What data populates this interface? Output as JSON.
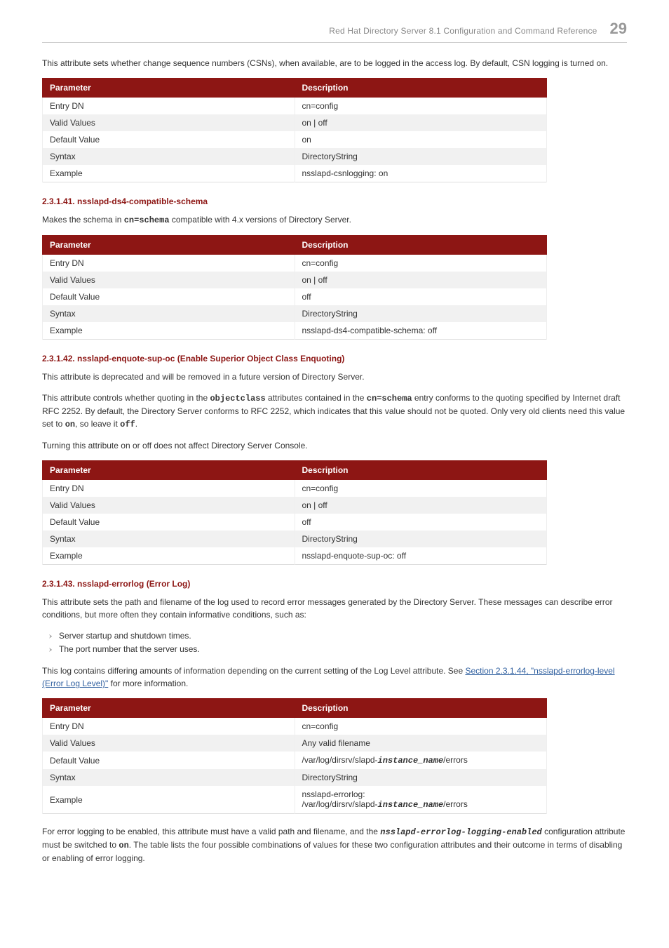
{
  "header": {
    "title": "Red Hat Directory Server 8.1 Configuration and Command Reference",
    "page_number": "29"
  },
  "intro_para": "This attribute sets whether change sequence numbers (CSNs), when available, are to be logged in the access log. By default, CSN logging is turned on.",
  "table_headers": {
    "param": "Parameter",
    "desc": "Description"
  },
  "table1": {
    "r1p": "Entry DN",
    "r1d": "cn=config",
    "r2p": "Valid Values",
    "r2d": "on | off",
    "r3p": "Default Value",
    "r3d": "on",
    "r4p": "Syntax",
    "r4d": "DirectoryString",
    "r5p": "Example",
    "r5d": "nsslapd-csnlogging: on"
  },
  "s41": {
    "heading": "2.3.1.41. nsslapd-ds4-compatible-schema",
    "para_before": "Makes the schema in ",
    "para_code": "cn=schema",
    "para_after": " compatible with 4.x versions of Directory Server."
  },
  "table2": {
    "r1p": "Entry DN",
    "r1d": "cn=config",
    "r2p": "Valid Values",
    "r2d": "on | off",
    "r3p": "Default Value",
    "r3d": "off",
    "r4p": "Syntax",
    "r4d": "DirectoryString",
    "r5p": "Example",
    "r5d": "nsslapd-ds4-compatible-schema: off"
  },
  "s42": {
    "heading": "2.3.1.42. nsslapd-enquote-sup-oc (Enable Superior Object Class Enquoting)",
    "para1": "This attribute is deprecated and will be removed in a future version of Directory Server.",
    "para2_a": "This attribute controls whether quoting in the ",
    "para2_code1": "objectclass",
    "para2_b": " attributes contained in the ",
    "para2_code2": "cn=schema",
    "para2_c": " entry conforms to the quoting specified by Internet draft RFC 2252. By default, the Directory Server conforms to RFC 2252, which indicates that this value should not be quoted. Only very old clients need this value set to ",
    "para2_code3": "on",
    "para2_d": ", so leave it ",
    "para2_code4": "off",
    "para2_e": ".",
    "para3": "Turning this attribute on or off does not affect Directory Server Console."
  },
  "table3": {
    "r1p": "Entry DN",
    "r1d": "cn=config",
    "r2p": "Valid Values",
    "r2d": "on | off",
    "r3p": "Default Value",
    "r3d": "off",
    "r4p": "Syntax",
    "r4d": "DirectoryString",
    "r5p": "Example",
    "r5d": "nsslapd-enquote-sup-oc: off"
  },
  "s43": {
    "heading": "2.3.1.43. nsslapd-errorlog (Error Log)",
    "para1": "This attribute sets the path and filename of the log used to record error messages generated by the Directory Server. These messages can describe error conditions, but more often they contain informative conditions, such as:",
    "bullet1": "Server startup and shutdown times.",
    "bullet2": "The port number that the server uses.",
    "para2_a": "This log contains differing amounts of information depending on the current setting of the Log Level attribute. See ",
    "para2_link": "Section 2.3.1.44, \"nsslapd-errorlog-level (Error Log Level)\"",
    "para2_b": " for more information."
  },
  "table4": {
    "r1p": "Entry DN",
    "r1d": "cn=config",
    "r2p": "Valid Values",
    "r2d": "Any valid filename",
    "r3p": "Default Value",
    "r3d_pre": "/var/log/dirsrv/slapd-",
    "r3d_it": "instance_name",
    "r3d_post": "/errors",
    "r4p": "Syntax",
    "r4d": "DirectoryString",
    "r5p": "Example",
    "r5d_line1": "nsslapd-errorlog:",
    "r5d_pre": "/var/log/dirsrv/slapd-",
    "r5d_it": "instance_name",
    "r5d_post": "/errors"
  },
  "final_para": {
    "a": "For error logging to be enabled, this attribute must have a valid path and filename, and the ",
    "code1": "nsslapd-errorlog-logging-enabled",
    "b": " configuration attribute must be switched to ",
    "code2": "on",
    "c": ". The table lists the four possible combinations of values for these two configuration attributes and their outcome in terms of disabling or enabling of error logging."
  }
}
